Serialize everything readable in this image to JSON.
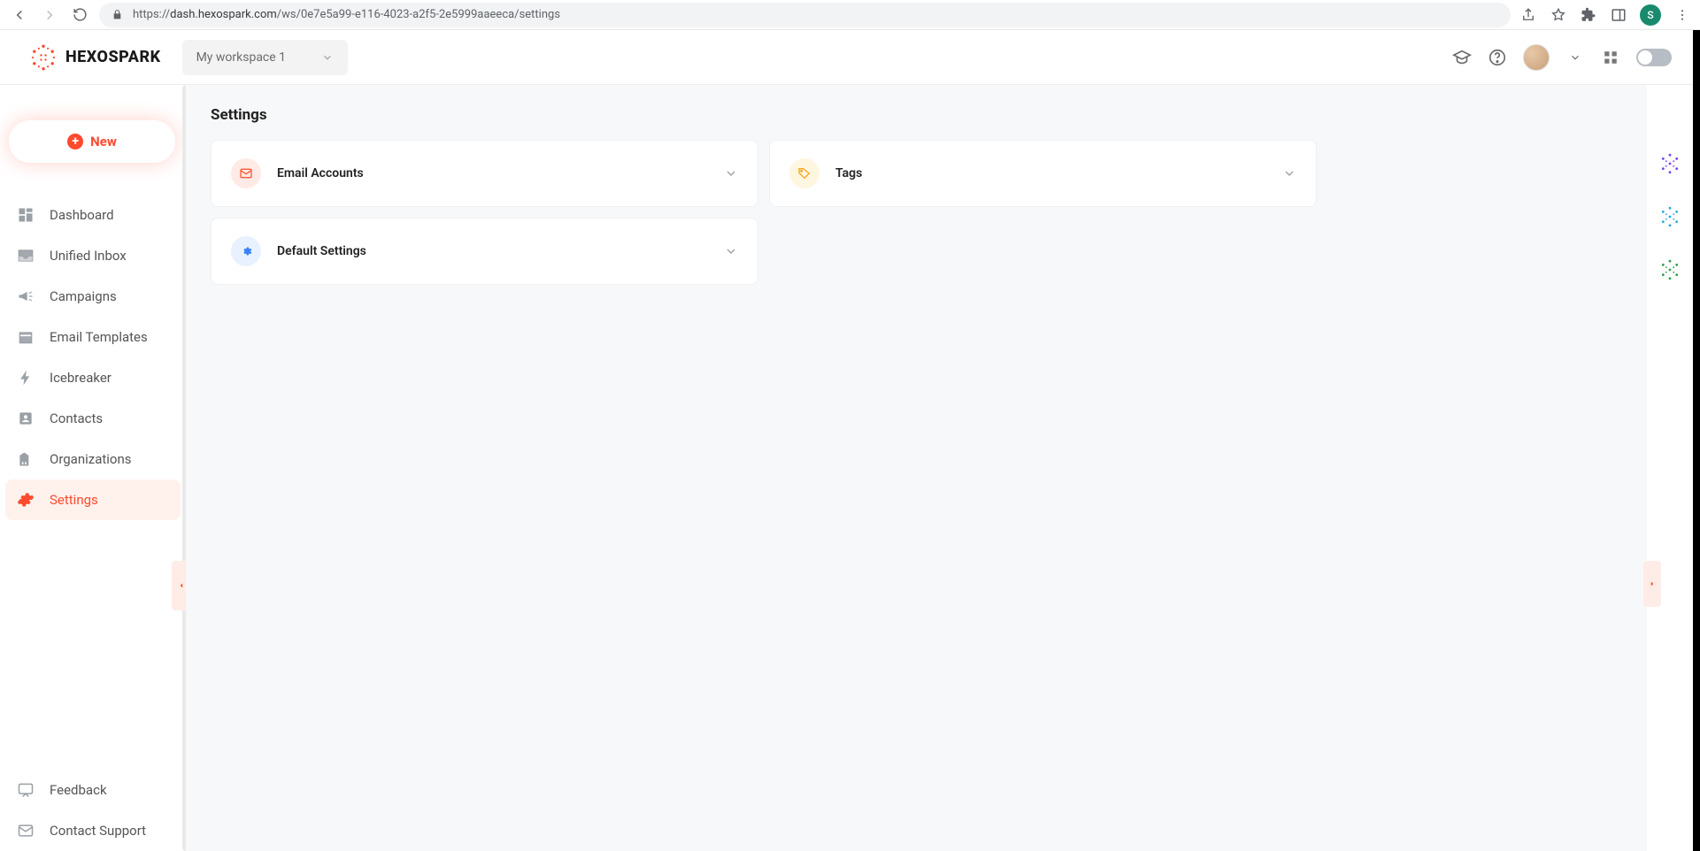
{
  "browser": {
    "url_prefix": "https://",
    "url_host": "dash.hexospark.com",
    "url_path": "/ws/0e7e5a99-e116-4023-a2f5-2e5999aaeeca/settings",
    "profile_initial": "S"
  },
  "header": {
    "brand": "HEXOSPARK",
    "workspace": "My workspace 1"
  },
  "sidebar": {
    "new_label": "New",
    "items": [
      {
        "label": "Dashboard"
      },
      {
        "label": "Unified Inbox"
      },
      {
        "label": "Campaigns"
      },
      {
        "label": "Email Templates"
      },
      {
        "label": "Icebreaker"
      },
      {
        "label": "Contacts"
      },
      {
        "label": "Organizations"
      },
      {
        "label": "Settings"
      }
    ],
    "bottom_items": [
      {
        "label": "Feedback"
      },
      {
        "label": "Contact Support"
      }
    ]
  },
  "main": {
    "title": "Settings",
    "cards": [
      {
        "label": "Email Accounts"
      },
      {
        "label": "Tags"
      },
      {
        "label": "Default Settings"
      }
    ]
  }
}
